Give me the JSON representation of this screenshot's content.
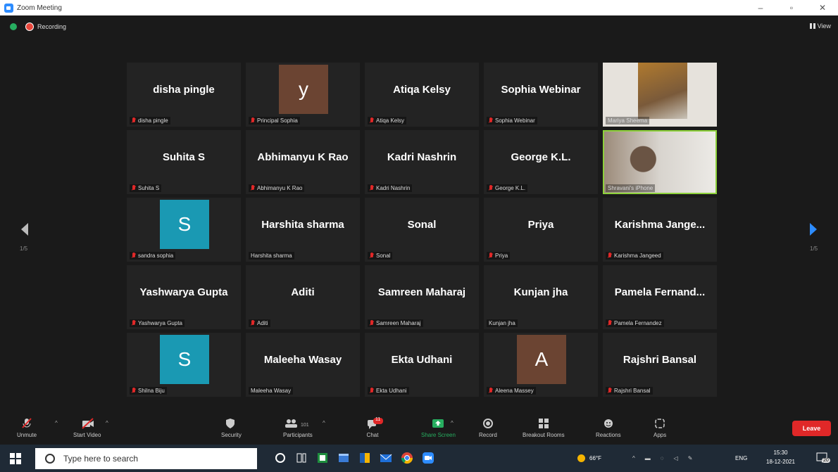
{
  "window": {
    "title": "Zoom Meeting",
    "minimize": "–",
    "maximize": "▫",
    "close": "✕"
  },
  "meeting_top": {
    "recording_label": "Recording",
    "view_label": "View"
  },
  "pagination": {
    "left_page": "1/5",
    "right_page": "1/5"
  },
  "tiles": [
    {
      "big": "disha pingle",
      "name": "disha pingle",
      "muted": true
    },
    {
      "avatar": "y",
      "avatar_color": "#6b4432",
      "name": "Principal Sophia",
      "muted": true
    },
    {
      "big": "Atiqa Kelsy",
      "name": "Atiqa Kelsy",
      "muted": true
    },
    {
      "big": "Sophia Webinar",
      "name": "Sophia Webinar",
      "muted": true
    },
    {
      "video": true,
      "name": "Mariya Sheema",
      "muted": false
    },
    {
      "big": "Suhita S",
      "name": "Suhita S",
      "muted": true
    },
    {
      "big": "Abhimanyu K Rao",
      "name": "Abhimanyu K Rao",
      "muted": true
    },
    {
      "big": "Kadri Nashrin",
      "name": "Kadri Nashrin",
      "muted": true
    },
    {
      "big": "George K.L.",
      "name": "George K.L.",
      "muted": true
    },
    {
      "video": true,
      "name": "Shravani's iPhone",
      "muted": false,
      "active_speaker": true
    },
    {
      "avatar": "S",
      "avatar_color": "#1a99b3",
      "name": "sandra sophia",
      "muted": true
    },
    {
      "big": "Harshita sharma",
      "name": "Harshita sharma",
      "muted": false
    },
    {
      "big": "Sonal",
      "name": "Sonal",
      "muted": true
    },
    {
      "big": "Priya",
      "name": "Priya",
      "muted": true
    },
    {
      "big": "Karishma  Jange...",
      "name": "Karishma Jangeed",
      "muted": true
    },
    {
      "big": "Yashwarya Gupta",
      "name": "Yashwarya Gupta",
      "muted": true
    },
    {
      "big": "Aditi",
      "name": "Aditi",
      "muted": true
    },
    {
      "big": "Samreen Maharaj",
      "name": "Samreen Maharaj",
      "muted": true
    },
    {
      "big": "Kunjan jha",
      "name": "Kunjan jha",
      "muted": false
    },
    {
      "big": "Pamela  Fernand...",
      "name": "Pamela Fernandez",
      "muted": true
    },
    {
      "avatar": "S",
      "avatar_color": "#1a99b3",
      "name": "Shilna Biju",
      "muted": true
    },
    {
      "big": "Maleeha Wasay",
      "name": "Maleeha Wasay",
      "muted": false
    },
    {
      "big": "Ekta Udhani",
      "name": "Ekta Udhani",
      "muted": true
    },
    {
      "avatar": "A",
      "avatar_color": "#6b4432",
      "name": "Aleena  Massey",
      "muted": true
    },
    {
      "big": "Rajshri Bansal",
      "name": "Rajshri Bansal",
      "muted": true
    }
  ],
  "toolbar": {
    "unmute": "Unmute",
    "start_video": "Start Video",
    "security": "Security",
    "participants": "Participants",
    "participants_count": "101",
    "chat": "Chat",
    "chat_badge": "11",
    "share_screen": "Share Screen",
    "record": "Record",
    "breakout_rooms": "Breakout Rooms",
    "reactions": "Reactions",
    "apps": "Apps",
    "leave": "Leave"
  },
  "taskbar": {
    "search_placeholder": "Type here to search",
    "weather": "66°F",
    "language": "ENG",
    "time": "15:30",
    "date": "18-12-2021",
    "notifications": "20"
  },
  "colors": {
    "zoom_blue": "#2d8cff",
    "leave_red": "#e02828",
    "active_green": "#8dd13b",
    "muted_red": "#e02828"
  }
}
